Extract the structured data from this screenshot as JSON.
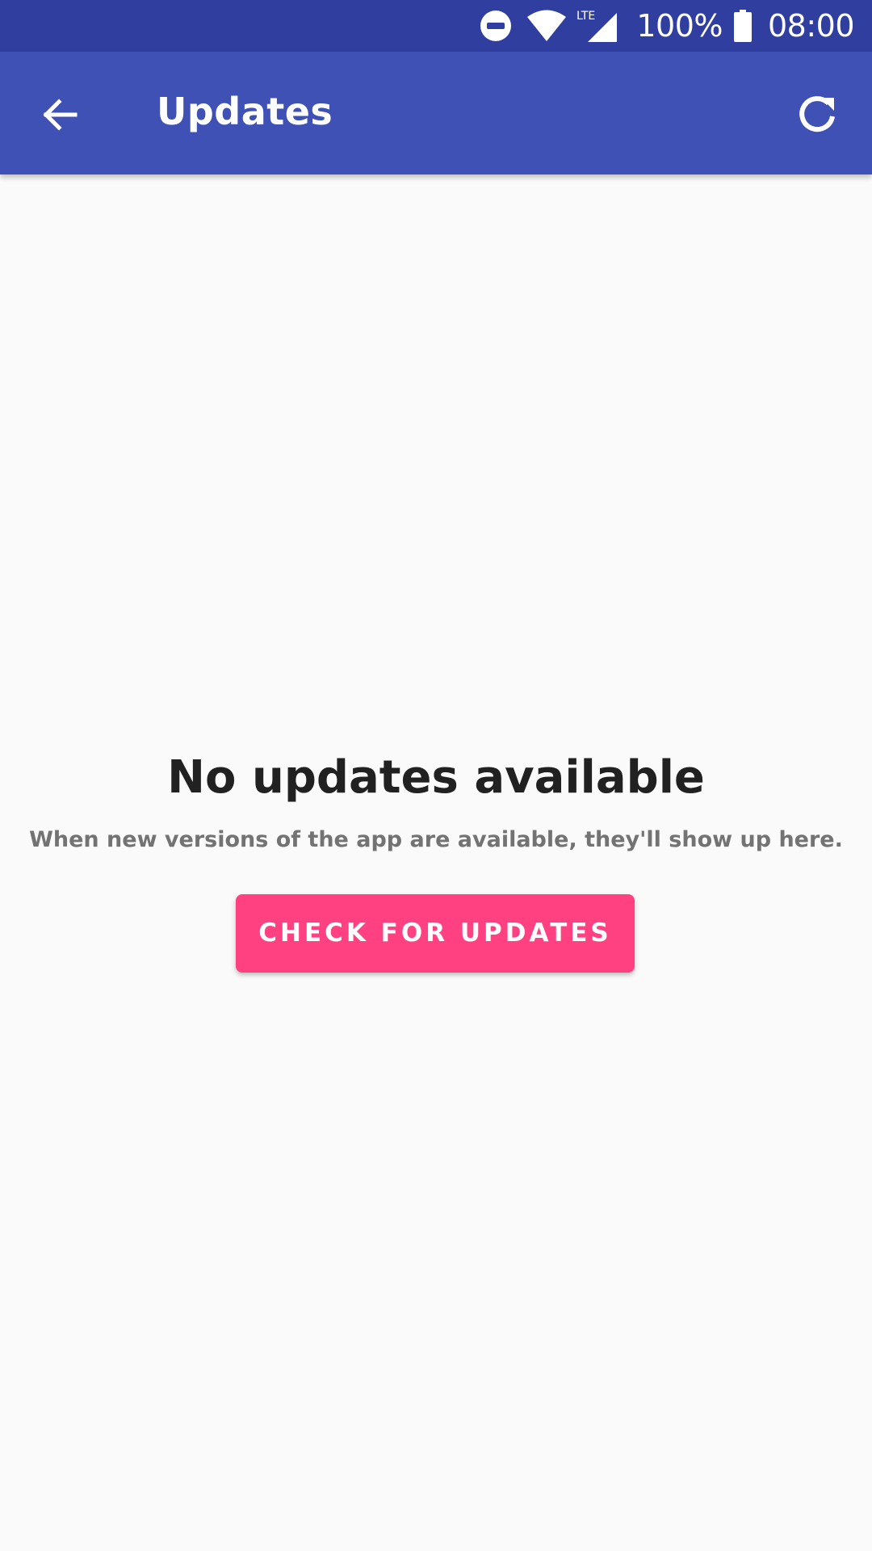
{
  "status_bar": {
    "icons": [
      "do-not-disturb-icon",
      "wifi-icon",
      "lte-signal-icon",
      "battery-icon"
    ],
    "lte_label": "LTE",
    "battery": "100%",
    "time": "08:00",
    "color": "#303f9f"
  },
  "app_bar": {
    "title": "Updates",
    "back_icon": "arrow-back-icon",
    "refresh_icon": "refresh-icon",
    "color": "#3f51b5"
  },
  "empty_state": {
    "title": "No updates available",
    "subtitle": "When new versions of the app are available, they'll show up here.",
    "button_label": "CHECK FOR UPDATES",
    "button_color": "#ff4081"
  }
}
